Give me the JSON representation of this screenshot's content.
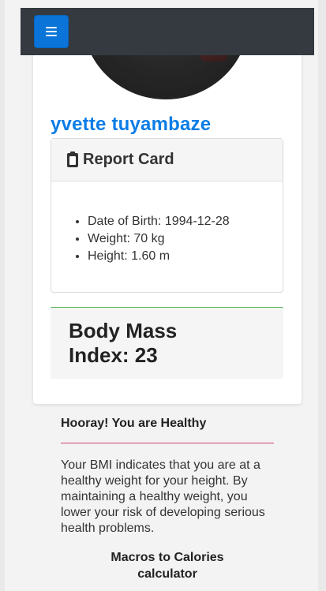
{
  "profile": {
    "name": "yvette tuyambaze"
  },
  "report_card": {
    "title": "Report Card",
    "icon": "clipboard-icon",
    "items": [
      {
        "label": "Date of Birth: 1994-12-28"
      },
      {
        "label": "Weight: 70 kg"
      },
      {
        "label": "Height: 1.60 m"
      }
    ]
  },
  "bmi": {
    "label_line1": "Body Mass",
    "label_line2": "Index: 23"
  },
  "result": {
    "heading": "Hooray! You are Healthy",
    "description": "Your BMI indicates that you are at a healthy weight for your height. By maintaining a healthy weight, you lower your risk of developing serious health problems."
  },
  "macros": {
    "title_line1": "Macros to Calories",
    "title_line2": "calculator"
  },
  "colors": {
    "navbar": "#343a40",
    "menu_button": "#0b74d8",
    "name": "#0b7de6",
    "divider": "#c2185b",
    "bmi_border": "#55b35a"
  }
}
